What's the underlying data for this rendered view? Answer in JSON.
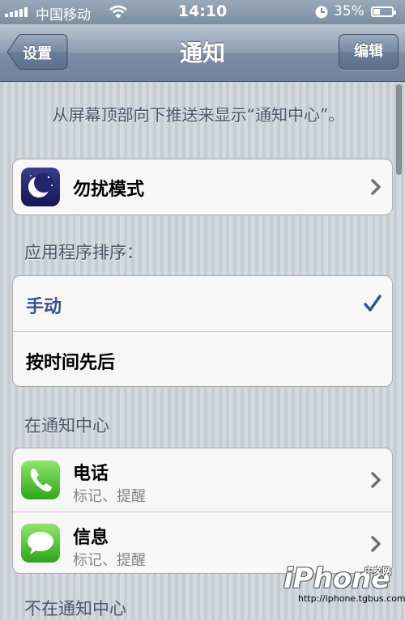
{
  "status_bar": {
    "carrier": "中国移动",
    "time": "14:10",
    "battery": "35%",
    "battery_level": 0.35
  },
  "nav": {
    "back_label": "设置",
    "title": "通知",
    "edit_label": "编辑"
  },
  "hint": "从屏幕顶部向下推送来显示“通知中心”。",
  "dnd": {
    "label": "勿扰模式"
  },
  "sort": {
    "header": "应用程序排序：",
    "options": [
      {
        "label": "手动",
        "selected": true
      },
      {
        "label": "按时间先后",
        "selected": false
      }
    ]
  },
  "in_center": {
    "header": "在通知中心",
    "apps": [
      {
        "name": "电话",
        "detail": "标记、提醒",
        "icon": "phone-icon"
      },
      {
        "name": "信息",
        "detail": "标记、提醒",
        "icon": "messages-icon"
      }
    ]
  },
  "not_in_center_header": "不在通知中心",
  "watermark": {
    "logo": "iPhone",
    "tag": "中文网",
    "url": "http://iphone.tgbus.com"
  },
  "colors": {
    "check": "#385487",
    "nav": "#7c8ea5",
    "section_text": "#4c566a"
  }
}
